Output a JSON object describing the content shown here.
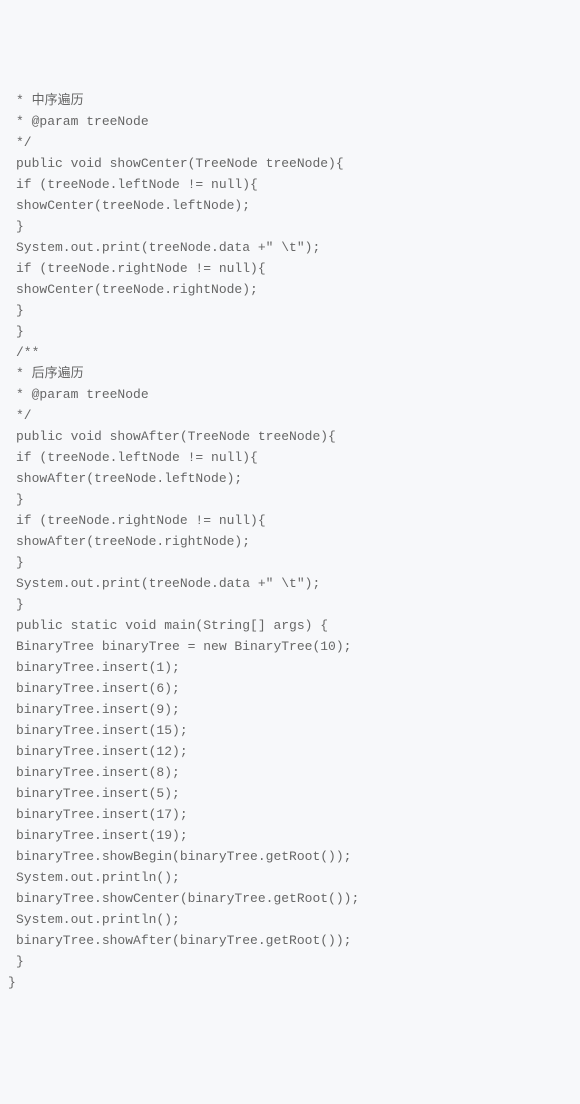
{
  "code": {
    "lines": [
      {
        "indent": 1,
        "text": "* 中序遍历"
      },
      {
        "indent": 1,
        "text": "* @param treeNode"
      },
      {
        "indent": 1,
        "text": "*/"
      },
      {
        "indent": 1,
        "text": "public void showCenter(TreeNode treeNode){"
      },
      {
        "indent": 1,
        "text": "if (treeNode.leftNode != null){"
      },
      {
        "indent": 1,
        "text": "showCenter(treeNode.leftNode);"
      },
      {
        "indent": 1,
        "text": "}"
      },
      {
        "indent": 1,
        "text": "System.out.print(treeNode.data +\" \\t\");"
      },
      {
        "indent": 1,
        "text": "if (treeNode.rightNode != null){"
      },
      {
        "indent": 1,
        "text": "showCenter(treeNode.rightNode);"
      },
      {
        "indent": 1,
        "text": "}"
      },
      {
        "indent": 1,
        "text": "}"
      },
      {
        "indent": 1,
        "text": "/**"
      },
      {
        "indent": 1,
        "text": "* 后序遍历"
      },
      {
        "indent": 1,
        "text": "* @param treeNode"
      },
      {
        "indent": 1,
        "text": "*/"
      },
      {
        "indent": 1,
        "text": "public void showAfter(TreeNode treeNode){"
      },
      {
        "indent": 1,
        "text": "if (treeNode.leftNode != null){"
      },
      {
        "indent": 1,
        "text": "showAfter(treeNode.leftNode);"
      },
      {
        "indent": 1,
        "text": "}"
      },
      {
        "indent": 1,
        "text": "if (treeNode.rightNode != null){"
      },
      {
        "indent": 1,
        "text": "showAfter(treeNode.rightNode);"
      },
      {
        "indent": 1,
        "text": "}"
      },
      {
        "indent": 1,
        "text": "System.out.print(treeNode.data +\" \\t\");"
      },
      {
        "indent": 1,
        "text": "}"
      },
      {
        "indent": 1,
        "text": "public static void main(String[] args) {"
      },
      {
        "indent": 1,
        "text": "BinaryTree binaryTree = new BinaryTree(10);"
      },
      {
        "indent": 1,
        "text": "binaryTree.insert(1);"
      },
      {
        "indent": 1,
        "text": "binaryTree.insert(6);"
      },
      {
        "indent": 1,
        "text": "binaryTree.insert(9);"
      },
      {
        "indent": 1,
        "text": "binaryTree.insert(15);"
      },
      {
        "indent": 1,
        "text": "binaryTree.insert(12);"
      },
      {
        "indent": 1,
        "text": "binaryTree.insert(8);"
      },
      {
        "indent": 1,
        "text": "binaryTree.insert(5);"
      },
      {
        "indent": 1,
        "text": "binaryTree.insert(17);"
      },
      {
        "indent": 1,
        "text": "binaryTree.insert(19);"
      },
      {
        "indent": 1,
        "text": "binaryTree.showBegin(binaryTree.getRoot());"
      },
      {
        "indent": 1,
        "text": "System.out.println();"
      },
      {
        "indent": 1,
        "text": "binaryTree.showCenter(binaryTree.getRoot());"
      },
      {
        "indent": 1,
        "text": "System.out.println();"
      },
      {
        "indent": 1,
        "text": "binaryTree.showAfter(binaryTree.getRoot());"
      },
      {
        "indent": 1,
        "text": "}"
      },
      {
        "indent": 0,
        "text": "}"
      }
    ]
  }
}
